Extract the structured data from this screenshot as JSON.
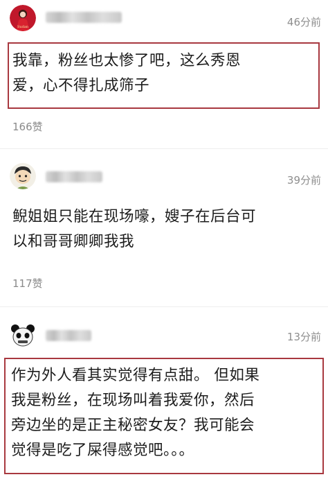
{
  "comments": [
    {
      "time": "46分前",
      "lines": [
        "我靠，粉丝也太惨了吧，这么秀恩",
        "爱，心不得扎成筛子"
      ],
      "likes": "166赞",
      "avatar_icon": "red-dress-avatar-icon"
    },
    {
      "time": "39分前",
      "lines": [
        "鲵姐姐只能在现场嚎，嫂子在后台可",
        "以和哥哥卿卿我我"
      ],
      "likes": "117赞",
      "avatar_icon": "cartoon-boy-avatar-icon"
    },
    {
      "time": "13分前",
      "lines": [
        "作为外人看其实觉得有点甜。 但如果",
        "我是粉丝，在现场叫着我爱你，然后",
        "旁边坐的是正主秘密女友？我可能会",
        "觉得是吃了屎得感觉吧。。。"
      ],
      "avatar_icon": "panda-meme-avatar-icon"
    }
  ],
  "colors": {
    "highlight_border": "#a8383f",
    "meta_text": "#8e8e8e"
  }
}
